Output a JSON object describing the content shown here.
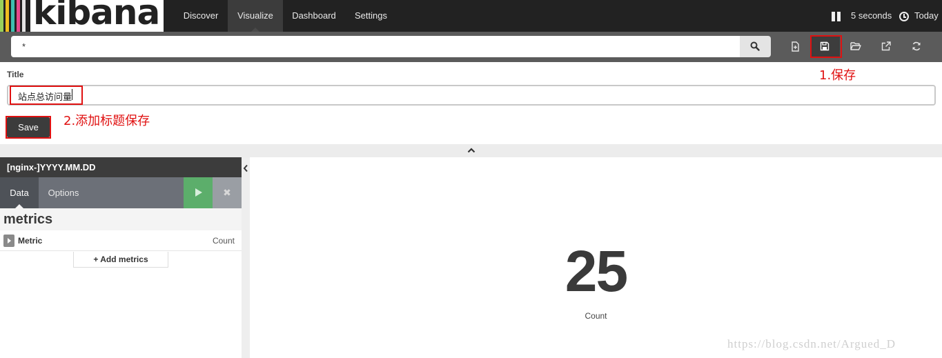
{
  "app": {
    "logo_text": "kibana",
    "brand_colors": [
      "#e8478b",
      "#f0bd1f",
      "#3ebeb0",
      "#9ad05b",
      "#e4e4e4"
    ]
  },
  "nav": {
    "tabs": [
      {
        "label": "Discover"
      },
      {
        "label": "Visualize",
        "active": true
      },
      {
        "label": "Dashboard"
      },
      {
        "label": "Settings"
      }
    ],
    "refresh_interval": "5 seconds",
    "time_range": "Today"
  },
  "search": {
    "query": "*"
  },
  "toolbar": {
    "icons": [
      "new-visualization-icon",
      "save-icon",
      "open-icon",
      "share-icon",
      "refresh-icon"
    ],
    "active": "save-icon"
  },
  "save_panel": {
    "title_label": "Title",
    "title_value": "站点总访问量",
    "save_label": "Save"
  },
  "annotations": {
    "step1": "1.保存",
    "step2": "2.添加标题保存",
    "color": "#e01010"
  },
  "sidebar": {
    "index_pattern": "[nginx-]YYYY.MM.DD",
    "tabs": [
      {
        "label": "Data",
        "active": true
      },
      {
        "label": "Options"
      }
    ],
    "discard_glyph": "✖",
    "section_title": "metrics",
    "metric_label": "Metric",
    "metric_value": "Count",
    "add_metrics_label": "Add metrics"
  },
  "visualization": {
    "value": "25",
    "caption": "Count"
  },
  "watermark": "https://blog.csdn.net/Argued_D"
}
